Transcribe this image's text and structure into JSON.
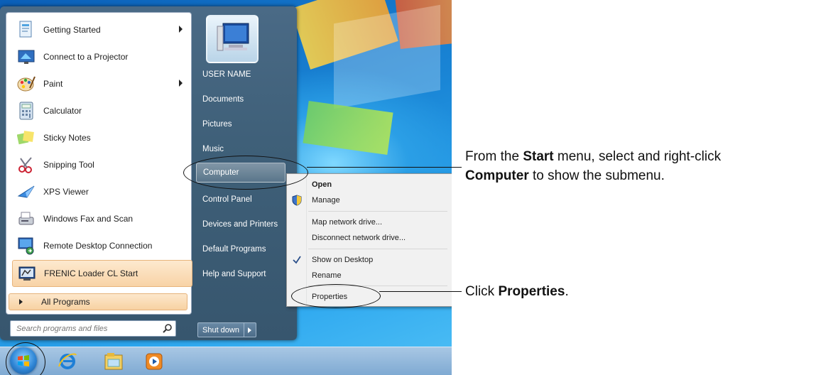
{
  "programs": [
    {
      "label": "Getting Started",
      "icon": "getting-started-icon",
      "has_submenu": true
    },
    {
      "label": "Connect to a Projector",
      "icon": "projector-icon",
      "has_submenu": false
    },
    {
      "label": "Paint",
      "icon": "paint-palette-icon",
      "has_submenu": true
    },
    {
      "label": "Calculator",
      "icon": "calculator-icon",
      "has_submenu": false
    },
    {
      "label": "Sticky Notes",
      "icon": "sticky-notes-icon",
      "has_submenu": false
    },
    {
      "label": "Snipping Tool",
      "icon": "scissors-icon",
      "has_submenu": false
    },
    {
      "label": "XPS Viewer",
      "icon": "xps-viewer-icon",
      "has_submenu": false
    },
    {
      "label": "Windows Fax and Scan",
      "icon": "fax-scanner-icon",
      "has_submenu": false
    },
    {
      "label": "Remote Desktop Connection",
      "icon": "remote-desktop-icon",
      "has_submenu": false
    },
    {
      "label": "FRENIC Loader CL Start",
      "icon": "frenic-loader-icon",
      "has_submenu": false
    }
  ],
  "all_programs_label": "All Programs",
  "search": {
    "placeholder": "Search programs and files"
  },
  "right_links": [
    "USER NAME",
    "Documents",
    "Pictures",
    "Music",
    "Computer",
    "Control Panel",
    "Devices and Printers",
    "Default Programs",
    "Help and Support"
  ],
  "shutdown_label": "Shut down",
  "context_menu": {
    "open": "Open",
    "manage": "Manage",
    "map_drive": "Map network drive...",
    "disconnect_drive": "Disconnect network drive...",
    "show_on_desktop": "Show on Desktop",
    "rename": "Rename",
    "properties": "Properties"
  },
  "callouts": {
    "computer": {
      "part1": "From the ",
      "bold1": "Start",
      "part2": " menu, select and right-click",
      "bold2": "Computer",
      "part3": " to show the submenu."
    },
    "properties": {
      "part1": "Click ",
      "bold1": "Properties",
      "part2": "."
    }
  },
  "taskbar_icons": [
    "internet-explorer-icon",
    "windows-explorer-icon",
    "media-player-icon"
  ],
  "colors": {
    "menu_frame": "#3f6079",
    "highlight": "#f8d3a6",
    "desktop_blue": "#1a86d6"
  }
}
